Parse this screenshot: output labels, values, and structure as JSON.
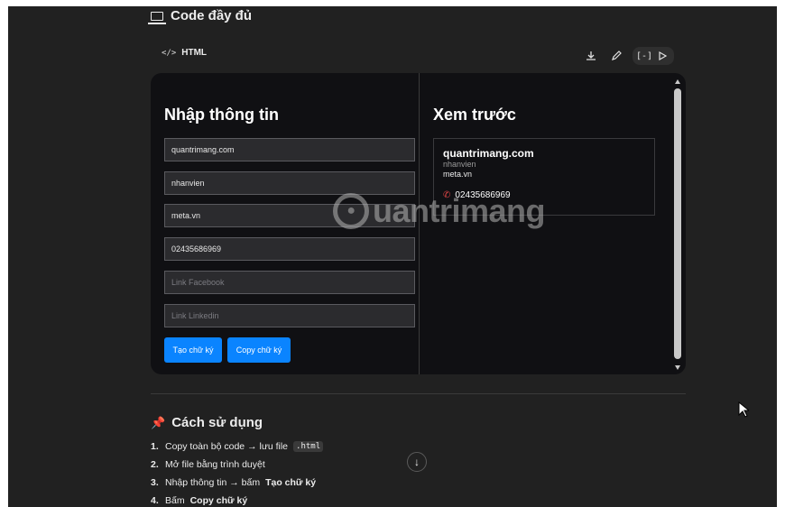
{
  "header": {
    "section_title": "Code đầy đủ",
    "language_label": "HTML",
    "toolbar": {
      "download_icon": "download-icon",
      "edit_icon": "pencil-icon",
      "code_toggle": "[-]",
      "run_icon": "play-icon"
    }
  },
  "form": {
    "heading": "Nhập thông tin",
    "fields": {
      "name": "quantrimang.com",
      "title": "nhanvien",
      "company": "meta.vn",
      "phone": "02435686969",
      "facebook_placeholder": "Link Facebook",
      "linkedin_placeholder": "Link Linkedin"
    },
    "buttons": {
      "create": "Tạo chữ ký",
      "copy": "Copy chữ ký"
    }
  },
  "preview": {
    "heading": "Xem trước",
    "card": {
      "name": "quantrimang.com",
      "title": "nhanvien",
      "company": "meta.vn",
      "phone": "02435686969"
    }
  },
  "watermark": "uantrimang",
  "usage": {
    "title": "Cách sử dụng",
    "steps": [
      {
        "num": "1.",
        "text": "Copy toàn bộ code → lưu file",
        "code": ".html"
      },
      {
        "num": "2.",
        "text": "Mở file bằng trình duyệt"
      },
      {
        "num": "3.",
        "text_before": "Nhập thông tin → bấm",
        "bold": "Tạo chữ ký"
      },
      {
        "num": "4.",
        "text_before": "Bấm",
        "bold": "Copy chữ ký"
      }
    ]
  },
  "colors": {
    "background": "#212121",
    "frame": "#101013",
    "accent": "#0a84ff",
    "phone_icon": "#e14646"
  }
}
